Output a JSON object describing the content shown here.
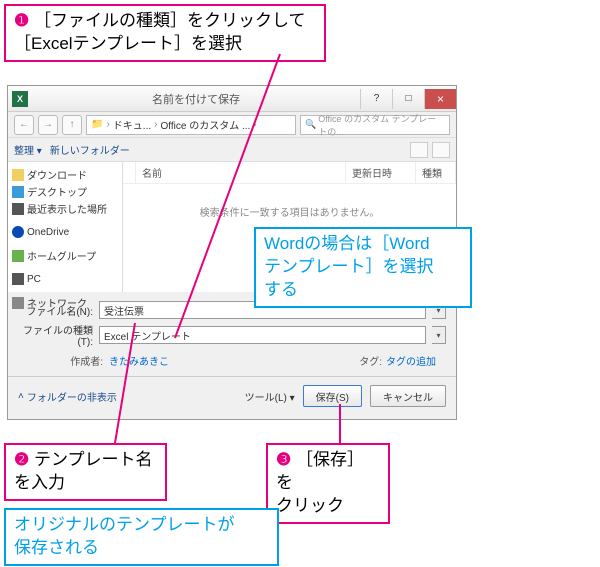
{
  "callouts": {
    "c1_num": "❶",
    "c1_text_a": "［ファイルの種類］をクリックして",
    "c1_text_b": "［Excelテンプレート］を選択",
    "c2_num": "❷",
    "c2_text_a": "テンプレート名",
    "c2_text_b": "を入力",
    "c3_num": "❸",
    "c3_text_a": "［保存］を",
    "c3_text_b": "クリック",
    "note1_a": "Wordの場合は［Word",
    "note1_b": "テンプレート］を選択",
    "note1_c": "する",
    "note2_a": "オリジナルのテンプレートが",
    "note2_b": "保存される"
  },
  "dialog": {
    "title": "名前を付けて保存",
    "breadcrumb": {
      "p1": "ドキュ...",
      "p2": "Office のカスタム ...",
      "sep": "›"
    },
    "search_placeholder": "Office のカスタム テンプレートの...",
    "toolbar": {
      "organize": "整理 ▾",
      "newfolder": "新しいフォルダー"
    },
    "tree": {
      "downloads": "ダウンロード",
      "desktop": "デスクトップ",
      "recent": "最近表示した場所",
      "onedrive": "OneDrive",
      "homegroup": "ホームグループ",
      "pc": "PC",
      "network": "ネットワーク"
    },
    "filelist": {
      "col_name": "名前",
      "col_date": "更新日時",
      "col_type": "種類",
      "empty": "検索条件に一致する項目はありません。"
    },
    "form": {
      "filename_label": "ファイル名(N):",
      "filename_value": "受注伝票",
      "filetype_label": "ファイルの種類(T):",
      "filetype_value": "Excel テンプレート",
      "author_label": "作成者:",
      "author_value": "きたみあきこ",
      "tag_label": "タグ:",
      "tag_value": "タグの追加"
    },
    "bottom": {
      "hidefolders": "フォルダーの非表示",
      "tools": "ツール(L) ▾",
      "save": "保存(S)",
      "cancel": "キャンセル"
    },
    "winbtns": {
      "close": "×",
      "max": "□",
      "help": "?"
    },
    "excel_icon": "X"
  }
}
